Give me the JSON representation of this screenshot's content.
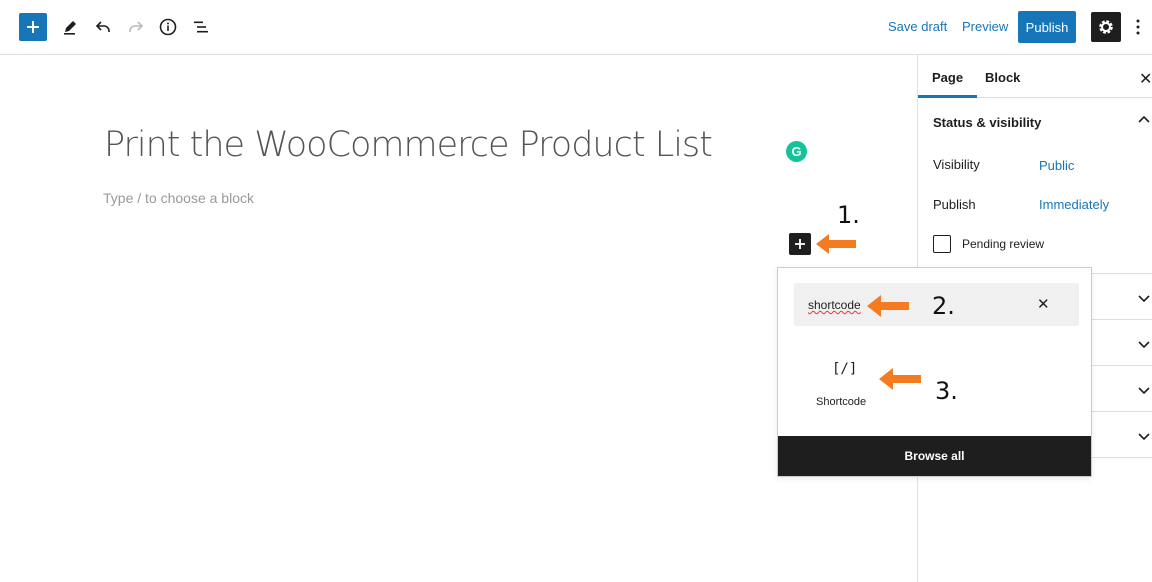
{
  "toolbar": {
    "save_draft": "Save draft",
    "preview": "Preview",
    "publish": "Publish"
  },
  "editor": {
    "title": "Print the WooCommerce Product List",
    "placeholder": "Type / to choose a block"
  },
  "annotations": {
    "step1": "1.",
    "step2": "2.",
    "step3": "3."
  },
  "sidebar": {
    "tabs": [
      {
        "label": "Page",
        "active": true
      },
      {
        "label": "Block",
        "active": false
      }
    ],
    "panel_title": "Status & visibility",
    "visibility_label": "Visibility",
    "visibility_value": "Public",
    "publish_label": "Publish",
    "publish_value": "Immediately",
    "pending_review_label": "Pending review",
    "pending_review_checked": false
  },
  "inserter": {
    "search_value": "shortcode",
    "result_label": "Shortcode",
    "result_icon": "[/]",
    "browse_all": "Browse all"
  },
  "colors": {
    "accent": "#1676b8",
    "dark": "#1e1e1e",
    "annotation_arrow": "#f47b20",
    "grammarly": "#15c39a"
  },
  "icons": [
    "plus-icon",
    "pencil-icon",
    "undo-icon",
    "redo-icon",
    "info-icon",
    "list-view-icon",
    "gear-icon",
    "more-vertical-icon",
    "close-icon",
    "chevron-up-icon",
    "chevron-down-icon",
    "shortcode-icon",
    "grammarly-icon",
    "arrow-left-icon"
  ]
}
